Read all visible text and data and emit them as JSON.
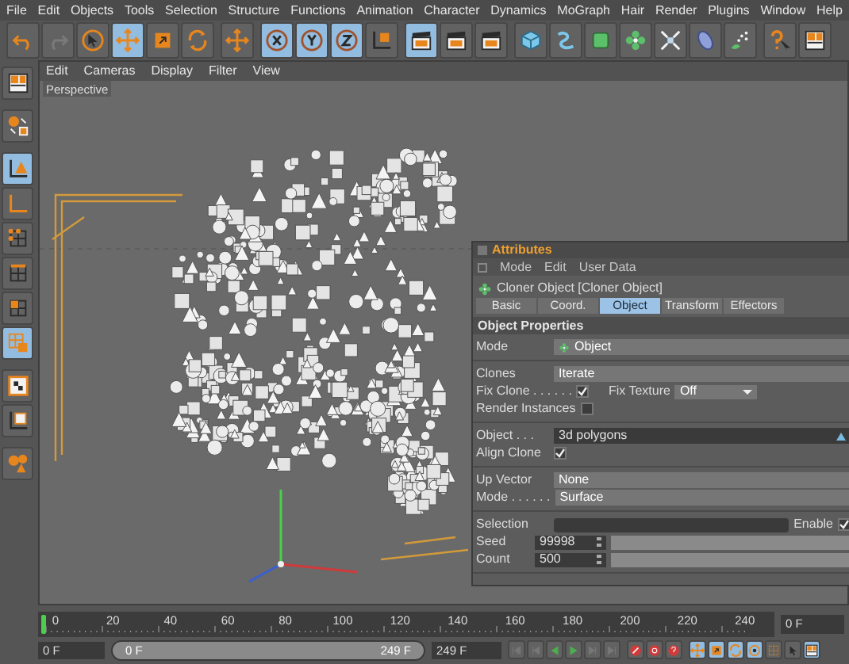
{
  "menu": [
    "File",
    "Edit",
    "Objects",
    "Tools",
    "Selection",
    "Structure",
    "Functions",
    "Animation",
    "Character",
    "Dynamics",
    "MoGraph",
    "Hair",
    "Render",
    "Plugins",
    "Window",
    "Help"
  ],
  "toolbar": [
    [
      {
        "kind": "undo",
        "selected": false
      },
      {
        "kind": "redo",
        "selected": false
      },
      {
        "kind": "select",
        "selected": false
      },
      {
        "kind": "move",
        "selected": true
      },
      {
        "kind": "scale",
        "selected": false
      },
      {
        "kind": "rotate",
        "selected": false
      }
    ],
    [
      {
        "kind": "move",
        "selected": false
      }
    ],
    [
      {
        "kind": "x",
        "selected": true
      },
      {
        "kind": "y",
        "selected": true
      },
      {
        "kind": "z",
        "selected": true
      },
      {
        "kind": "coords",
        "selected": false
      }
    ],
    [
      {
        "kind": "clapper",
        "selected": true
      },
      {
        "kind": "clapper",
        "selected": false
      },
      {
        "kind": "clapper",
        "selected": false
      }
    ],
    [
      {
        "kind": "cube",
        "selected": false
      },
      {
        "kind": "spline",
        "selected": false
      },
      {
        "kind": "nurbs",
        "selected": false
      },
      {
        "kind": "array",
        "selected": false
      },
      {
        "kind": "deformer",
        "selected": false
      },
      {
        "kind": "scene",
        "selected": false
      },
      {
        "kind": "particles",
        "selected": false
      }
    ],
    [
      {
        "kind": "help",
        "selected": false
      },
      {
        "kind": "layout",
        "selected": false
      }
    ]
  ],
  "left_toolbar": [
    [
      {
        "kind": "layout",
        "selected": false
      }
    ],
    [
      {
        "kind": "objects",
        "selected": false
      }
    ],
    [
      {
        "kind": "model",
        "selected": true
      },
      {
        "kind": "axis",
        "selected": false
      },
      {
        "kind": "points",
        "selected": false
      },
      {
        "kind": "edges",
        "selected": false
      },
      {
        "kind": "polygons",
        "selected": false
      },
      {
        "kind": "uv",
        "selected": true
      }
    ],
    [
      {
        "kind": "texture",
        "selected": false
      },
      {
        "kind": "texture-axis",
        "selected": false
      }
    ],
    [
      {
        "kind": "sculpt",
        "selected": false
      }
    ]
  ],
  "viewport": {
    "menu": [
      "Edit",
      "Cameras",
      "Display",
      "Filter",
      "View"
    ],
    "label": "Perspective"
  },
  "attributes": {
    "title": "Attributes",
    "menu": [
      "Mode",
      "Edit",
      "User Data"
    ],
    "object": "Cloner Object [Cloner Object]",
    "tabs": [
      {
        "label": "Basic",
        "selected": false
      },
      {
        "label": "Coord.",
        "selected": false
      },
      {
        "label": "Object",
        "selected": true
      },
      {
        "label": "Transform",
        "selected": false
      },
      {
        "label": "Effectors",
        "selected": false
      }
    ],
    "section": "Object Properties",
    "groups": [
      [
        {
          "items": [
            {
              "kind": "dropdown",
              "label": "Mode",
              "value": "Object",
              "icon": true
            }
          ]
        }
      ],
      [
        {
          "items": [
            {
              "kind": "dropdown",
              "label": "Clones",
              "value": "Iterate"
            }
          ]
        },
        {
          "items": [
            {
              "kind": "checkbox",
              "label": "Fix Clone . . . . . .",
              "checked": true
            },
            {
              "kind": "select",
              "label": "Fix Texture",
              "value": "Off"
            }
          ]
        },
        {
          "items": [
            {
              "kind": "checkbox",
              "label": "Render Instances",
              "checked": false
            }
          ]
        }
      ],
      [
        {
          "items": [
            {
              "kind": "link",
              "label": "Object . . .",
              "value": "3d polygons"
            }
          ]
        },
        {
          "items": [
            {
              "kind": "checkbox",
              "label": "Align Clone",
              "checked": true
            }
          ]
        }
      ],
      [
        {
          "items": [
            {
              "kind": "dropdown",
              "label": "Up Vector",
              "value": "None"
            }
          ]
        },
        {
          "items": [
            {
              "kind": "dropdown",
              "label": "Mode . . . . . .",
              "value": "Surface"
            }
          ]
        }
      ],
      [
        {
          "items": [
            {
              "kind": "text",
              "label": "Selection",
              "value": ""
            },
            {
              "kind": "checkbox",
              "label": "Enable",
              "checked": true
            }
          ]
        },
        {
          "items": [
            {
              "kind": "number",
              "label": "Seed",
              "value": "99998"
            }
          ]
        },
        {
          "items": [
            {
              "kind": "number",
              "label": "Count",
              "value": "500"
            }
          ]
        }
      ]
    ]
  },
  "timeline": {
    "ticks": [
      "0",
      "20",
      "40",
      "60",
      "80",
      "100",
      "120",
      "140",
      "160",
      "180",
      "200",
      "220",
      "240"
    ],
    "current": "0 F",
    "start": "0 F",
    "range": {
      "start": "0 F",
      "end": "249 F",
      "level": 1
    },
    "end": "249 F",
    "transport": [
      {
        "kind": "first",
        "selected": false
      },
      {
        "kind": "prev",
        "selected": false
      },
      {
        "kind": "play-back",
        "selected": false
      },
      {
        "kind": "play",
        "selected": false
      },
      {
        "kind": "next",
        "selected": false
      },
      {
        "kind": "last",
        "selected": false
      }
    ],
    "record": [
      {
        "kind": "record",
        "selected": false
      },
      {
        "kind": "autokey",
        "selected": false
      },
      {
        "kind": "keysel",
        "selected": false
      }
    ],
    "keys": [
      {
        "kind": "move",
        "selected": true
      },
      {
        "kind": "scale",
        "selected": true
      },
      {
        "kind": "rotate",
        "selected": true
      },
      {
        "kind": "param",
        "selected": true
      },
      {
        "kind": "grid",
        "selected": false
      },
      {
        "kind": "pointer",
        "selected": false
      },
      {
        "kind": "layout",
        "selected": true
      }
    ]
  }
}
